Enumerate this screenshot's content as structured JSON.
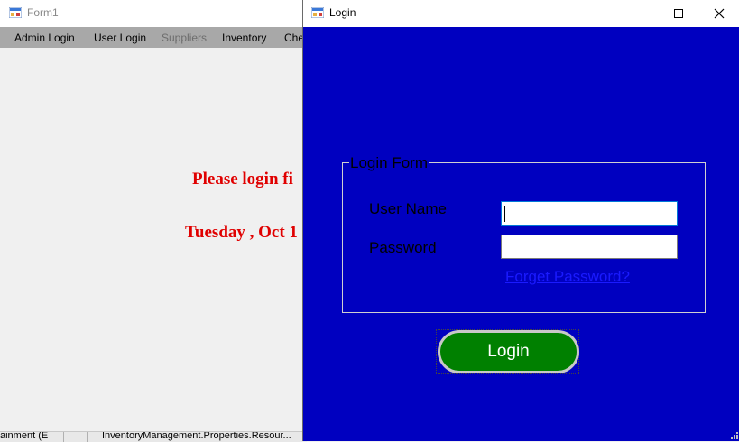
{
  "form1": {
    "title": "Form1",
    "menu": [
      {
        "label": "Admin Login",
        "enabled": true
      },
      {
        "label": "User Login",
        "enabled": true
      },
      {
        "label": "Suppliers",
        "enabled": false
      },
      {
        "label": "Inventory",
        "enabled": true
      },
      {
        "label": "Che",
        "enabled": true
      }
    ],
    "message": "Please login fi",
    "date": "Tuesday , Oct 1",
    "status_parts": [
      "ainment (E",
      "InventoryManagement.Properties.Resour..."
    ]
  },
  "login": {
    "title": "Login",
    "group_title": "Login Form",
    "username_label": "User Name",
    "password_label": "Password",
    "username_value": "",
    "password_value": "",
    "forgot_link": "Forget Password?",
    "login_button": "Login"
  },
  "colors": {
    "login_bg": "#0000c0",
    "login_button": "#008000",
    "message_red": "#e00000",
    "link_blue": "#1a1aff"
  },
  "icons": [
    "form-icon",
    "minimize-icon",
    "maximize-icon",
    "close-icon",
    "resize-grip-icon"
  ]
}
